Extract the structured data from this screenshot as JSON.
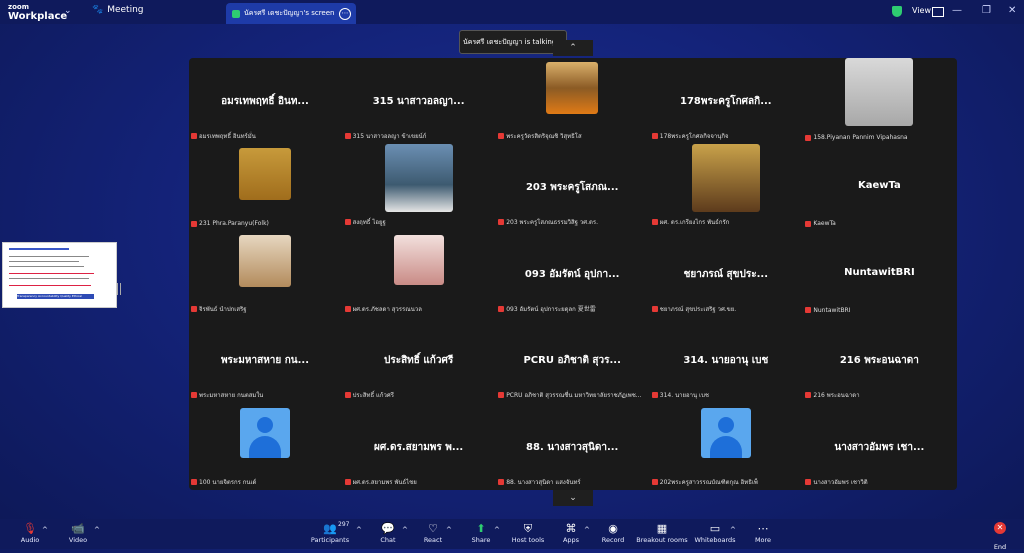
{
  "titlebar": {
    "logo_line1": "zoom",
    "logo_line2": "Workplace",
    "meeting_label": "Meeting",
    "share_tab_label": "นัครศรี เดชะปัญญา's screen",
    "view_label": "View"
  },
  "talking_indicator": "นัครศรี เดชะปัญญา is talking...",
  "participants": [
    {
      "name": "อมรเทพฤทธิ์ อินท...",
      "caption": "อมรเทพฤทธิ์ อินทร์มั่น",
      "media": "none"
    },
    {
      "name": "315 นาสาวอลญา...",
      "caption": "315 นาสาวอลญา ข้าเขยน์ก์",
      "media": "none"
    },
    {
      "name": "",
      "caption": "พระครูวัดรสิตริจุณชิ วิสุทธิโส",
      "media": "photo-monk"
    },
    {
      "name": "178พระครูโกศลกิ...",
      "caption": "178พระครูโกศลกิจจานุกิจ",
      "media": "none"
    },
    {
      "name": "",
      "caption": "158.Piyanan Pannim Vipahasna",
      "media": "photo-woman"
    },
    {
      "name": "",
      "caption": "231 Phra.Paranyu(Folk)",
      "media": "photo-mustard"
    },
    {
      "name": "",
      "caption": "สงฤทธิ์ ไอยูฐ",
      "media": "photo-office"
    },
    {
      "name": "203 พระครูโสภณ...",
      "caption": "203 พระครูโสภณธรรมวิสิฐ วศ.ดร.",
      "media": "none"
    },
    {
      "name": "",
      "caption": "ผศ. ดร.เกรียงไกร พันธ์กรัก",
      "media": "photo-gold"
    },
    {
      "name": "KaewTa",
      "caption": "KaewTa",
      "media": "none"
    },
    {
      "name": "",
      "caption": "จิรพันธ์ นำปกเสริฐ",
      "media": "photo-white"
    },
    {
      "name": "",
      "caption": "ผศ.ดร.ภัชลดา สุวรรณนวล",
      "media": "photo-pink"
    },
    {
      "name": "093 อัมรัตน์ อุปกา...",
      "caption": "093 อัมรัตน์ อุปการะยดุลก 夏世雷",
      "media": "none"
    },
    {
      "name": "ชยาภรณ์ สุขประ...",
      "caption": "ชยาภรณ์ สุขประเสริฐ วศ.ขย.",
      "media": "none"
    },
    {
      "name": "NuntawitBRI",
      "caption": "NuntawitBRI",
      "media": "none"
    },
    {
      "name": "พระมหาสหาย กน...",
      "caption": "พระมหาสหาย กนตสมใน",
      "media": "none"
    },
    {
      "name": "ประสิทธิ์ แก้วศรี",
      "caption": "ประสิทธิ์ แก้วศรี",
      "media": "none"
    },
    {
      "name": "PCRU อภิชาติ สุวร...",
      "caption": "PCRU อภิชาติ สุวรรณชื่น มหาวิทยาลัยราชภัฏเพช...",
      "media": "none"
    },
    {
      "name": "314. นายอานุ เบช",
      "caption": "314. นายอานุ เบช",
      "media": "none"
    },
    {
      "name": "216 พระอนฉาดา",
      "caption": "216 พระอนฉาดา",
      "media": "none"
    },
    {
      "name": "",
      "caption": "100 นายจิตรกร กนเด์",
      "media": "avatar"
    },
    {
      "name": "ผศ.ดร.สยามพร พ...",
      "caption": "ผศ.ดร.สยามพร พันธ์ไชย",
      "media": "none"
    },
    {
      "name": "88. นางสาวสุนิดา...",
      "caption": "88. นางสาวสุนิดา แสงจันทร์",
      "media": "none"
    },
    {
      "name": "",
      "caption": "202พระครูสาวรรณบัณฑิตกุณ อิทธิเพ็",
      "media": "avatar"
    },
    {
      "name": "นางสาวอัมพร เชา...",
      "caption": "นางสาวอัมพร เชาวิติ",
      "media": "none"
    }
  ],
  "slide": {
    "button_text": "Transparency Accountability Quality Ethical"
  },
  "toolbar": {
    "audio": "Audio",
    "video": "Video",
    "participants": "Participants",
    "participant_count": "297",
    "chat": "Chat",
    "react": "React",
    "share": "Share",
    "host_tools": "Host tools",
    "apps": "Apps",
    "record": "Record",
    "breakout": "Breakout rooms",
    "whiteboards": "Whiteboards",
    "more": "More",
    "end": "End"
  },
  "colors": {
    "background": "#14237a",
    "grid": "#1a1a1a",
    "muted_mic": "#e53935",
    "share_green": "#2ecc71",
    "avatar_blue": "#5aa7ee"
  }
}
